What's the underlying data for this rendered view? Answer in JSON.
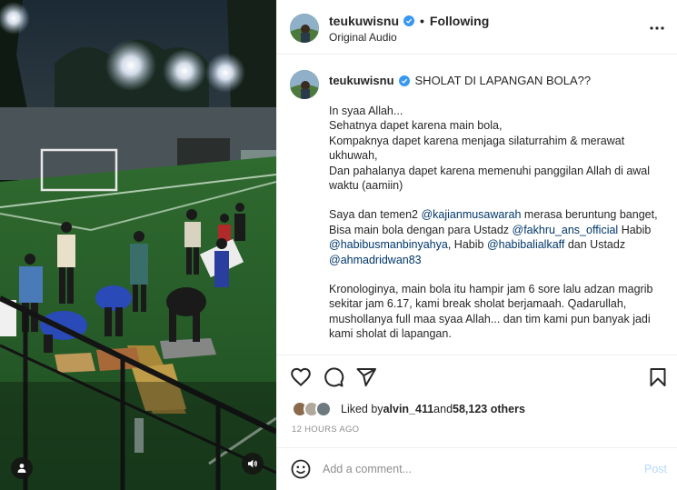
{
  "header": {
    "username": "teukuwisnu",
    "follow_status": "Following",
    "audio": "Original Audio"
  },
  "caption": {
    "username": "teukuwisnu",
    "title": "SHOLAT DI LAPANGAN BOLA??",
    "p1": [
      "In syaa Allah...",
      "Sehatnya dapet karena main bola,",
      "Kompaknya dapet karena menjaga silaturrahim & merawat",
      "ukhuwah,",
      "Dan pahalanya dapet karena memenuhi panggilan Allah di awal",
      "waktu (aamiin)"
    ],
    "p2": {
      "l1_a": "Saya dan temen2 ",
      "l1_m": "@kajianmusawarah",
      "l1_b": " merasa beruntung banget,",
      "l2_a": "Bisa main bola dengan para Ustadz ",
      "l2_m": "@fakhru_ans_official",
      "l2_b": " Habib",
      "l3_m1": "@habibusmanbinyahya",
      "l3_a": ", Habib ",
      "l3_m2": "@habibalialkaff",
      "l3_b": " dan Ustadz",
      "l4_m": "@ahmadridwan83"
    },
    "p3": [
      "Kronologinya, main bola itu hampir jam 6 sore lalu adzan magrib",
      "sekitar jam 6.17, kami break sholat berjamaah. Qadarullah,",
      "mushollanya full maa syaa Allah... dan tim kami pun banyak jadi",
      "kami sholat di lapangan."
    ]
  },
  "likes": {
    "prefix": "Liked by ",
    "user": "alvin_411",
    "mid": " and ",
    "count": "58,123 others"
  },
  "timestamp": "12 HOURS AGO",
  "comment": {
    "placeholder": "Add a comment...",
    "post_label": "Post"
  },
  "icons": {
    "verified": "verified-badge-icon",
    "more": "more-options-icon",
    "like": "heart-icon",
    "comment": "comment-icon",
    "share": "paper-plane-icon",
    "save": "bookmark-icon",
    "emoji": "emoji-icon",
    "user_tag": "user-tag-icon",
    "sound": "speaker-icon"
  },
  "colors": {
    "verified": "#3897f0",
    "mention": "#00376b",
    "post_disabled": "#b3dbff",
    "muted": "#8e8e8e"
  }
}
